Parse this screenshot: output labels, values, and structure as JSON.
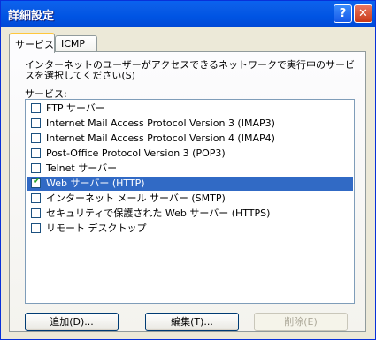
{
  "window": {
    "title": "詳細設定",
    "help_button": "?",
    "close_button": "✕"
  },
  "tabs": [
    {
      "label": "サービス",
      "active": true
    },
    {
      "label": "ICMP",
      "active": false
    }
  ],
  "description": "インターネットのユーザーがアクセスできるネットワークで実行中のサービスを選択してください(S)",
  "services_label": "サービス:",
  "services": [
    {
      "label": "FTP サーバー",
      "checked": false,
      "selected": false
    },
    {
      "label": "Internet Mail Access Protocol Version 3 (IMAP3)",
      "checked": false,
      "selected": false
    },
    {
      "label": "Internet Mail Access Protocol Version 4 (IMAP4)",
      "checked": false,
      "selected": false
    },
    {
      "label": "Post-Office Protocol Version 3 (POP3)",
      "checked": false,
      "selected": false
    },
    {
      "label": "Telnet サーバー",
      "checked": false,
      "selected": false
    },
    {
      "label": "Web サーバー (HTTP)",
      "checked": true,
      "selected": true
    },
    {
      "label": "インターネット メール サーバー (SMTP)",
      "checked": false,
      "selected": false
    },
    {
      "label": "セキュリティで保護された Web サーバー (HTTPS)",
      "checked": false,
      "selected": false
    },
    {
      "label": "リモート デスクトップ",
      "checked": false,
      "selected": false
    }
  ],
  "buttons": {
    "add": "追加(D)...",
    "edit": "編集(T)...",
    "delete": "削除(E)"
  },
  "check_glyph": "✔"
}
